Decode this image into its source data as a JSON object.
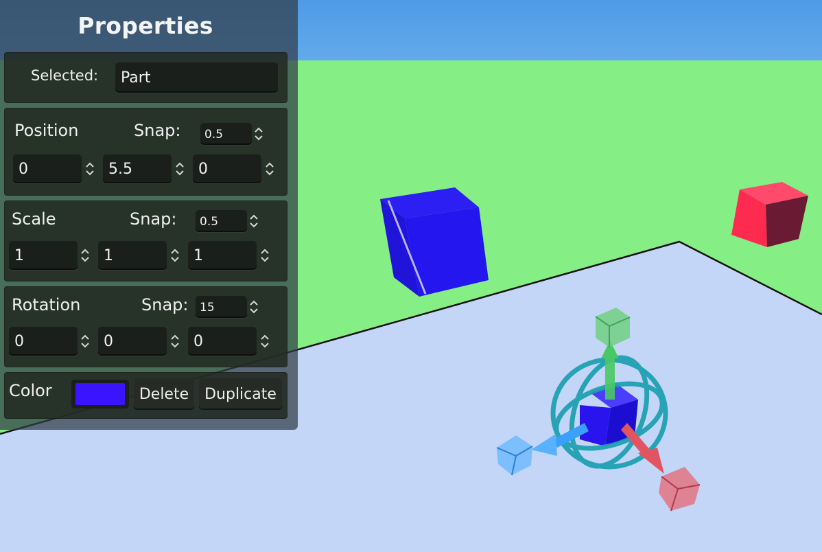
{
  "panel": {
    "title": "Properties",
    "selected_label": "Selected:",
    "selected_value": "Part",
    "position": {
      "label": "Position",
      "snap_label": "Snap:",
      "snap": "0.5",
      "x": "0",
      "y": "5.5",
      "z": "0"
    },
    "scale": {
      "label": "Scale",
      "snap_label": "Snap:",
      "snap": "0.5",
      "x": "1",
      "y": "1",
      "z": "1"
    },
    "rotation": {
      "label": "Rotation",
      "snap_label": "Snap:",
      "snap": "15",
      "x": "0",
      "y": "0",
      "z": "0"
    },
    "color_label": "Color",
    "color_value": "#3a14ff",
    "delete_label": "Delete",
    "duplicate_label": "Duplicate"
  },
  "scene": {
    "sky_color": "#5ba3e6",
    "grass_color": "#85ee84",
    "floor_color": "#c3d6f7",
    "selected_part_color": "#2a14ee",
    "blue_cube_color": "#2416f0",
    "red_cube_color": "#ff2a50",
    "gizmo_x_color": "#e05561",
    "gizmo_y_color": "#4ac864",
    "gizmo_z_color": "#3a9fff",
    "gizmo_rotate_color": "#1a9fb0"
  }
}
